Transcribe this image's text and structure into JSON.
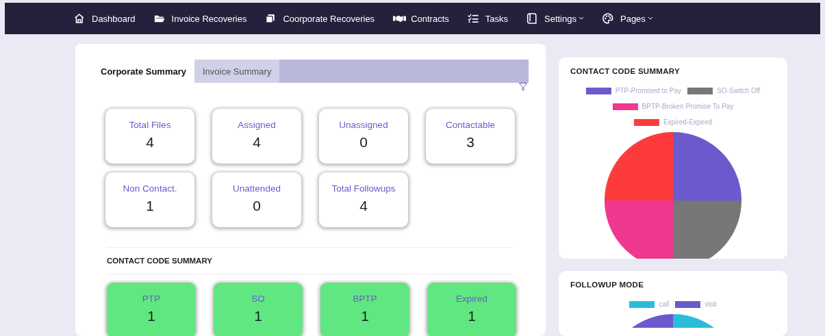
{
  "nav": {
    "items": [
      {
        "label": "Dashboard",
        "caret": false
      },
      {
        "label": "Invoice Recoveries",
        "caret": false
      },
      {
        "label": "Coorporate Recoveries",
        "caret": false
      },
      {
        "label": "Contracts",
        "caret": false
      },
      {
        "label": "Tasks",
        "caret": false
      },
      {
        "label": "Settings",
        "caret": true
      },
      {
        "label": "Pages",
        "caret": true
      }
    ]
  },
  "summary": {
    "tabs": [
      {
        "label": "Corporate Summary",
        "selected": true
      },
      {
        "label": "Invoice Summary",
        "selected": false
      }
    ],
    "stats": [
      {
        "label": "Total Files",
        "value": "4"
      },
      {
        "label": "Assigned",
        "value": "4"
      },
      {
        "label": "Unassigned",
        "value": "0"
      },
      {
        "label": "Contactable",
        "value": "3"
      },
      {
        "label": "Non Contact.",
        "value": "1"
      },
      {
        "label": "Unattended",
        "value": "0"
      },
      {
        "label": "Total Followups",
        "value": "4"
      }
    ],
    "contact_title": "CONTACT CODE SUMMARY",
    "contact_codes": [
      {
        "label": "PTP",
        "value": "1"
      },
      {
        "label": "SO",
        "value": "1"
      },
      {
        "label": "BPTP",
        "value": "1"
      },
      {
        "label": "Expired",
        "value": "1"
      }
    ]
  },
  "charts": [
    {
      "title": "CONTACT CODE SUMMARY",
      "legend": [
        {
          "label": "PTP-Promised to Pay",
          "color": "#6a5acd"
        },
        {
          "label": "SO-Switch Off",
          "color": "#777777"
        },
        {
          "label": "BPTP-Broken Promise To Pay",
          "color": "#f0388f"
        },
        {
          "label": "Expired-Expired",
          "color": "#fd3b3d"
        }
      ]
    },
    {
      "title": "FOLLOWUP MODE",
      "legend": [
        {
          "label": "call",
          "color": "#2bbcdb"
        },
        {
          "label": "visit",
          "color": "#6a5acd"
        }
      ]
    }
  ]
}
